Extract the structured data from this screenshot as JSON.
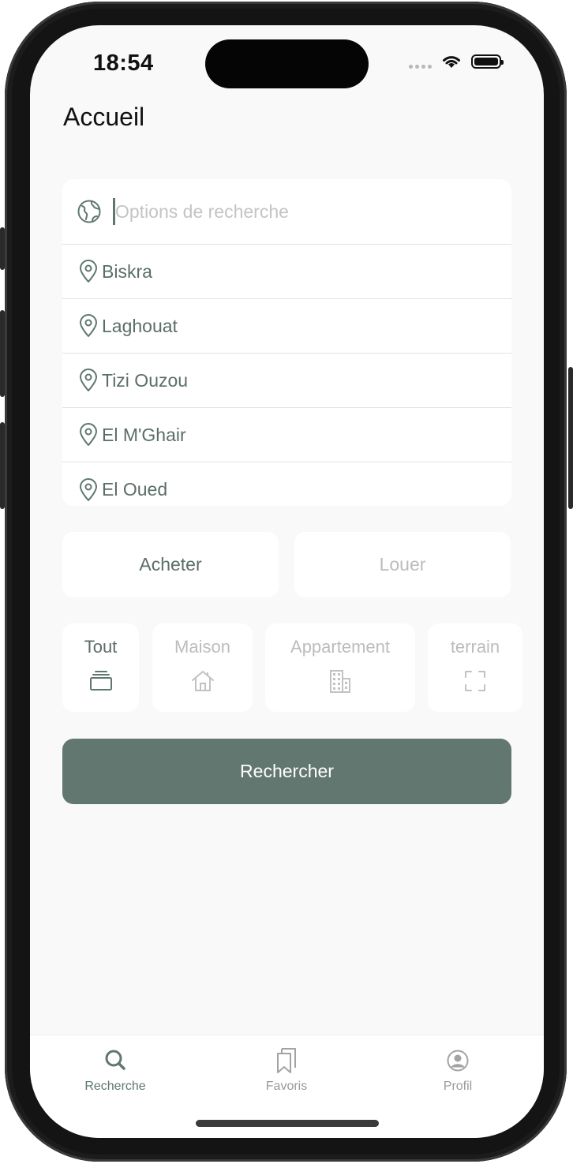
{
  "status_bar": {
    "time": "18:54"
  },
  "header": {
    "title": "Accueil"
  },
  "search": {
    "placeholder": "Options de recherche",
    "value": "",
    "icon": "globe-icon"
  },
  "locations": [
    {
      "label": "Biskra",
      "icon": "map-pin-icon"
    },
    {
      "label": "Laghouat",
      "icon": "map-pin-icon"
    },
    {
      "label": "Tizi Ouzou",
      "icon": "map-pin-icon"
    },
    {
      "label": "El M'Ghair",
      "icon": "map-pin-icon"
    },
    {
      "label": "El Oued",
      "icon": "map-pin-icon"
    }
  ],
  "transaction_modes": {
    "buy": "Acheter",
    "rent": "Louer",
    "selected": "buy"
  },
  "property_types": {
    "all": "Tout",
    "house": "Maison",
    "apartment": "Appartement",
    "land": "terrain",
    "selected": "all"
  },
  "actions": {
    "search_label": "Rechercher"
  },
  "tab_bar": {
    "search": "Recherche",
    "favorites": "Favoris",
    "profile": "Profil",
    "selected": "search"
  },
  "colors": {
    "accent": "#627770",
    "text_accent": "#5a6e67",
    "inactive": "#bcbcbc",
    "background": "#f9f9f9"
  }
}
